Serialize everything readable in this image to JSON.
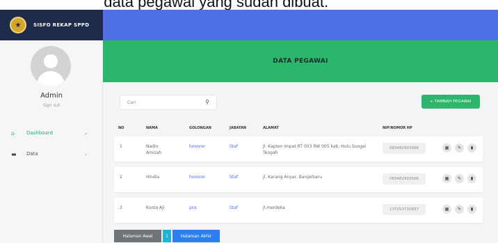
{
  "caption": "dalah tampilan data pegawai yang sudah dibuat.",
  "brand": {
    "title": "SISFO REKAP SPPD"
  },
  "profile": {
    "name": "Admin",
    "subtitle": "Sign out"
  },
  "sidebar": {
    "items": [
      {
        "label": "Dashboard",
        "icon": "home-icon"
      },
      {
        "label": "Data",
        "icon": "folder-icon"
      }
    ]
  },
  "banner": {
    "title": "DATA PEGAWAI"
  },
  "search": {
    "placeholder": "Cari"
  },
  "add_button": {
    "label": "+ TAMBAH PEGAWAI"
  },
  "table": {
    "headers": [
      "NO",
      "NAMA",
      "GOLONGAN",
      "JABATAN",
      "ALAMAT",
      "NIP/NOMOR HP"
    ],
    "rows": [
      {
        "no": "1",
        "nama": "Nadin Amizah",
        "golongan": "honorer",
        "jabatan": "Staf",
        "alamat": "Jl. Kapten Impat RT 003 RW 005 kab. Hulu Sungai Tengah",
        "hp": "083482903566"
      },
      {
        "no": "2",
        "nama": "Hindia",
        "golongan": "honorer",
        "jabatan": "Staf",
        "alamat": "jl. Karang Anyar, Banjarbaru",
        "hp": "083482903566"
      },
      {
        "no": "3",
        "nama": "Kunto Aji",
        "golongan": "pns",
        "jabatan": "Staf",
        "alamat": "jl.merdeka",
        "hp": "137253710837"
      }
    ]
  },
  "pager": {
    "first": "Halaman Awal",
    "current": "1",
    "last": "Halaman Akhir"
  },
  "colors": {
    "topbar": "#4e70e4",
    "banner": "#2cb66b",
    "brand": "#1e2a4a",
    "link": "#4b6fe6"
  }
}
